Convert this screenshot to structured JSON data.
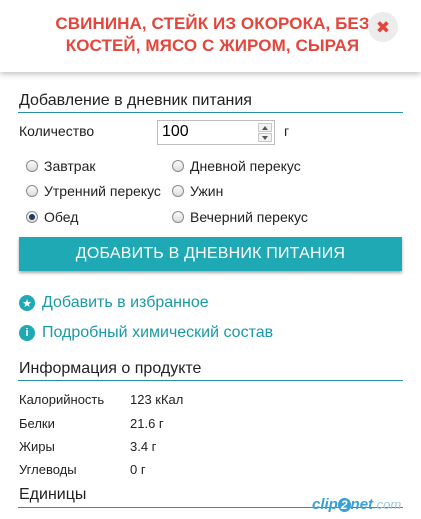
{
  "header": {
    "title_line1": "СВИНИНА, СТЕЙК ИЗ ОКОРОКА, БЕЗ",
    "title_line2": "КОСТЕЙ, МЯСО С ЖИРОМ, СЫРАЯ",
    "close_icon": "✖"
  },
  "diary": {
    "section_title": "Добавление в дневник питания",
    "quantity_label": "Количество",
    "quantity_value": "100",
    "unit": "г",
    "meals": [
      {
        "label": "Завтрак",
        "checked": false
      },
      {
        "label": "Дневной перекус",
        "checked": false
      },
      {
        "label": "Утренний перекус",
        "checked": false
      },
      {
        "label": "Ужин",
        "checked": false
      },
      {
        "label": "Обед",
        "checked": true
      },
      {
        "label": "Вечерний перекус",
        "checked": false
      }
    ],
    "add_button": "ДОБАВИТЬ В ДНЕВНИК ПИТАНИЯ"
  },
  "links": {
    "favorites": "Добавить в избранное",
    "composition": "Подробный химический состав",
    "favorites_icon": "star-icon",
    "info_icon": "info-icon"
  },
  "product_info": {
    "section_title": "Информация о продукте",
    "rows": [
      {
        "label": "Калорийность",
        "value": "123 кКал"
      },
      {
        "label": "Белки",
        "value": "21.6 г"
      },
      {
        "label": "Жиры",
        "value": "3.4 г"
      },
      {
        "label": "Углеводы",
        "value": "0 г"
      }
    ]
  },
  "units": {
    "section_title": "Единицы"
  },
  "watermark": {
    "part1": "clip",
    "part2": "2",
    "part3": "net",
    "part4": ".com"
  },
  "colors": {
    "title_red": "#e4463b",
    "accent_teal": "#1fa9b4",
    "rule_blue": "#2a8fa8"
  }
}
